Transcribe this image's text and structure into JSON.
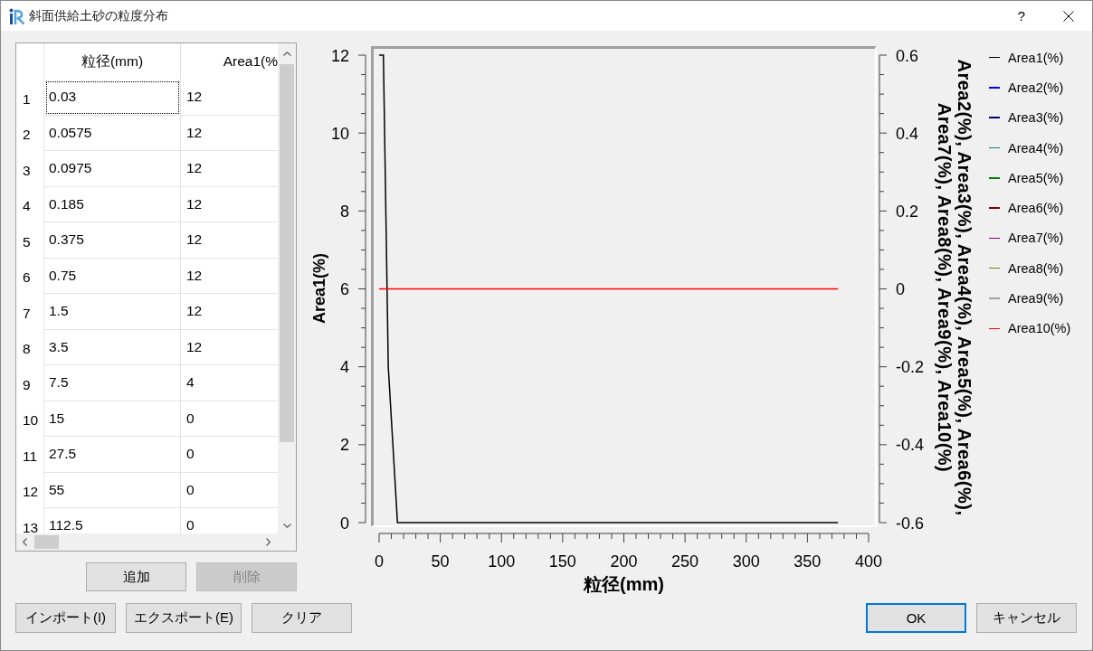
{
  "window": {
    "title": "斜面供給土砂の粒度分布",
    "help_button": "?"
  },
  "table": {
    "columns": [
      "粒径(mm)",
      "Area1(%"
    ],
    "rows": [
      {
        "number": "1",
        "cells": [
          {
            "text": "0.03",
            "focused": true
          },
          {
            "text": "12",
            "focused": false
          }
        ]
      },
      {
        "number": "2",
        "cells": [
          {
            "text": "0.0575",
            "focused": false
          },
          {
            "text": "12",
            "focused": false
          }
        ]
      },
      {
        "number": "3",
        "cells": [
          {
            "text": "0.0975",
            "focused": false
          },
          {
            "text": "12",
            "focused": false
          }
        ]
      },
      {
        "number": "4",
        "cells": [
          {
            "text": "0.185",
            "focused": false
          },
          {
            "text": "12",
            "focused": false
          }
        ]
      },
      {
        "number": "5",
        "cells": [
          {
            "text": "0.375",
            "focused": false
          },
          {
            "text": "12",
            "focused": false
          }
        ]
      },
      {
        "number": "6",
        "cells": [
          {
            "text": "0.75",
            "focused": false
          },
          {
            "text": "12",
            "focused": false
          }
        ]
      },
      {
        "number": "7",
        "cells": [
          {
            "text": "1.5",
            "focused": false
          },
          {
            "text": "12",
            "focused": false
          }
        ]
      },
      {
        "number": "8",
        "cells": [
          {
            "text": "3.5",
            "focused": false
          },
          {
            "text": "12",
            "focused": false
          }
        ]
      },
      {
        "number": "9",
        "cells": [
          {
            "text": "7.5",
            "focused": false
          },
          {
            "text": "4",
            "focused": false
          }
        ]
      },
      {
        "number": "10",
        "cells": [
          {
            "text": "15",
            "focused": false
          },
          {
            "text": "0",
            "focused": false
          }
        ]
      },
      {
        "number": "11",
        "cells": [
          {
            "text": "27.5",
            "focused": false
          },
          {
            "text": "0",
            "focused": false
          }
        ]
      },
      {
        "number": "12",
        "cells": [
          {
            "text": "55",
            "focused": false
          },
          {
            "text": "0",
            "focused": false
          }
        ]
      },
      {
        "number": "13",
        "cells": [
          {
            "text": "112.5",
            "focused": false
          },
          {
            "text": "0",
            "focused": false
          }
        ]
      }
    ]
  },
  "table_buttons": [
    {
      "label": "追加",
      "disabled": false
    },
    {
      "label": "削除",
      "disabled": true
    }
  ],
  "chart": {
    "chart_data": {
      "type": "line",
      "xlabel": "粒径(mm)",
      "ylabel": "Area1(%)",
      "y2label": [
        "Area2(%), Area3(%), Area4(%), Area5(%), Area6(%),",
        "Area7(%), Area8(%), Area9(%), Area10(%)"
      ],
      "x": [
        0.03,
        0.0575,
        0.0975,
        0.185,
        0.375,
        0.75,
        1.5,
        3.5,
        7.5,
        15,
        27.5,
        55,
        112.5,
        375
      ],
      "series": [
        {
          "name": "Area1(%)",
          "color": "#000000",
          "values": [
            12,
            12,
            12,
            12,
            12,
            12,
            12,
            12,
            4,
            0,
            0,
            0,
            0,
            0
          ]
        },
        {
          "name": "Area2(%)",
          "color": "#0000ff",
          "values": [
            null,
            null,
            null,
            null,
            null,
            null,
            null,
            null,
            null,
            null,
            null,
            null,
            null,
            null
          ]
        },
        {
          "name": "Area3(%)",
          "color": "#000080",
          "values": [
            null,
            null,
            null,
            null,
            null,
            null,
            null,
            null,
            null,
            null,
            null,
            null,
            null,
            null
          ]
        },
        {
          "name": "Area4(%)",
          "color": "#008080",
          "values": [
            null,
            null,
            null,
            null,
            null,
            null,
            null,
            null,
            null,
            null,
            null,
            null,
            null,
            null
          ]
        },
        {
          "name": "Area5(%)",
          "color": "#008000",
          "values": [
            null,
            null,
            null,
            null,
            null,
            null,
            null,
            null,
            null,
            null,
            null,
            null,
            null,
            null
          ]
        },
        {
          "name": "Area6(%)",
          "color": "#800000",
          "values": [
            null,
            null,
            null,
            null,
            null,
            null,
            null,
            null,
            null,
            null,
            null,
            null,
            null,
            null
          ]
        },
        {
          "name": "Area7(%)",
          "color": "#800080",
          "values": [
            null,
            null,
            null,
            null,
            null,
            null,
            null,
            null,
            null,
            null,
            null,
            null,
            null,
            null
          ]
        },
        {
          "name": "Area8(%)",
          "color": "#808000",
          "values": [
            null,
            null,
            null,
            null,
            null,
            null,
            null,
            null,
            null,
            null,
            null,
            null,
            null,
            null
          ]
        },
        {
          "name": "Area9(%)",
          "color": "#a0a0a4",
          "values": [
            null,
            null,
            null,
            null,
            null,
            null,
            null,
            null,
            null,
            null,
            null,
            null,
            null,
            null
          ]
        },
        {
          "name": "Area10(%)",
          "color": "#ff0000",
          "axis": "y2",
          "values": [
            0,
            0,
            0,
            0,
            0,
            0,
            0,
            0,
            0,
            0,
            0,
            0,
            0,
            0
          ]
        }
      ],
      "xlim": [
        0,
        400
      ],
      "ylim": [
        0,
        12
      ],
      "y2lim": [
        -0.6,
        0.6
      ],
      "xticks": [
        0,
        50,
        100,
        150,
        200,
        250,
        300,
        350,
        400
      ],
      "yticks": [
        0,
        2,
        4,
        6,
        8,
        10,
        12
      ],
      "y2ticks": [
        -0.6,
        -0.4,
        -0.2,
        0,
        0.2,
        0.4,
        0.6
      ]
    }
  },
  "footer": {
    "left_buttons": [
      {
        "label": "インポート(I)",
        "default": false
      },
      {
        "label": "エクスポート(E)",
        "default": false
      },
      {
        "label": "クリア",
        "default": false
      }
    ],
    "right_buttons": [
      {
        "label": "OK",
        "default": true
      },
      {
        "label": "キャンセル",
        "default": false
      }
    ]
  }
}
